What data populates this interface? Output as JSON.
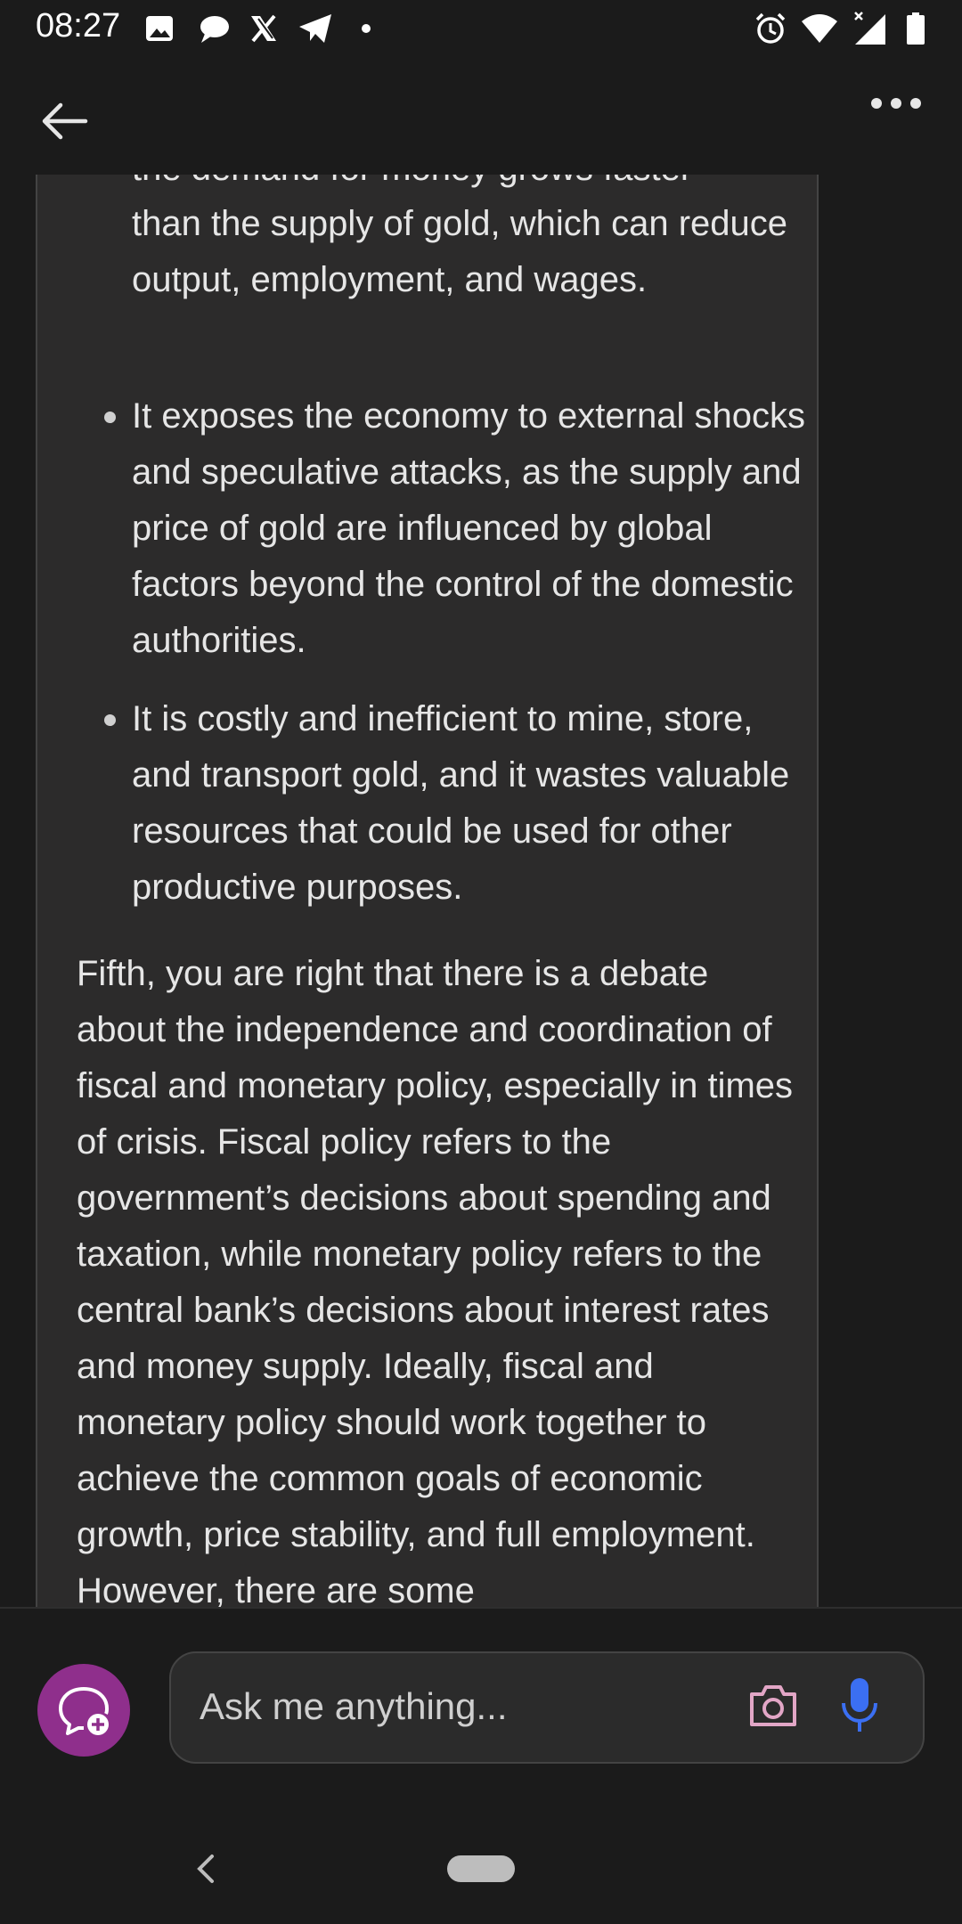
{
  "status_bar": {
    "time": "08:27",
    "left_icons": [
      "gallery-icon",
      "chat-bubble-icon",
      "x-logo-icon",
      "telegram-icon",
      "notification-dot-icon"
    ],
    "right_icons": [
      "alarm-icon",
      "wifi-icon",
      "cellular-no-signal-icon",
      "battery-icon"
    ]
  },
  "top_bar": {
    "back_icon": "arrow-left-icon",
    "menu_icon": "more-horizontal-icon"
  },
  "message": {
    "bullets": [
      {
        "partial_top": "the demand for money grows faster",
        "text": "than the supply of gold, which can reduce output, employment, and wages."
      },
      {
        "text": "It exposes the economy to external shocks and speculative attacks, as the supply and price of gold are influenced by global factors beyond the control of the domestic authorities."
      },
      {
        "text": "It is costly and inefficient to mine, store, and transport gold, and it wastes valuable resources that could be used for other productive purposes."
      }
    ],
    "paragraph": "Fifth, you are right that there is a debate about the independence and coordination of fiscal and monetary policy, especially in times of crisis. Fiscal policy refers to the government’s decisions about spending and taxation, while monetary policy refers to the central bank’s decisions about interest rates and money supply. Ideally, fiscal and monetary policy should work together to achieve the common goals of economic growth, price stability, and full employment. However, there are some"
  },
  "composer": {
    "placeholder": "Ask me anything...",
    "new_topic_icon": "new-topic-chat-icon",
    "camera_icon": "camera-icon",
    "mic_icon": "microphone-icon",
    "colors": {
      "new_topic_bg": "#8f2f8c",
      "camera": "#e2a6c6",
      "mic": "#3b6ff2"
    }
  },
  "nav_bar": {
    "back_icon": "chevron-left-icon",
    "home_icon": "home-pill-icon"
  }
}
